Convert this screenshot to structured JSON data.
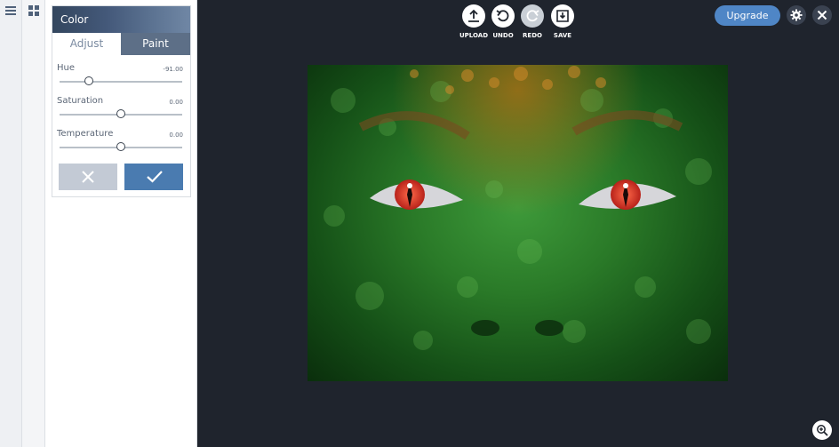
{
  "panel": {
    "title": "Color",
    "tabs": {
      "adjust": "Adjust",
      "paint": "Paint"
    },
    "controls": [
      {
        "label": "Hue",
        "value": "-91.00",
        "level": 0.24
      },
      {
        "label": "Saturation",
        "value": "0.00",
        "level": 0.5
      },
      {
        "label": "Temperature",
        "value": "0.00",
        "level": 0.5
      }
    ]
  },
  "toolbar": {
    "upload": "UPLOAD",
    "undo": "UNDO",
    "redo": "REDO",
    "save": "SAVE",
    "upgrade": "Upgrade"
  },
  "colors": {
    "accent": "#4f86c6",
    "confirm": "#4a7bb0",
    "canvas_bg": "#1f242d"
  },
  "icons": [
    "menu-icon",
    "grid-icon",
    "upload-icon",
    "undo-icon",
    "redo-icon",
    "save-icon",
    "settings-icon",
    "close-icon",
    "zoom-in-icon",
    "cancel-x-icon",
    "confirm-check-icon"
  ]
}
